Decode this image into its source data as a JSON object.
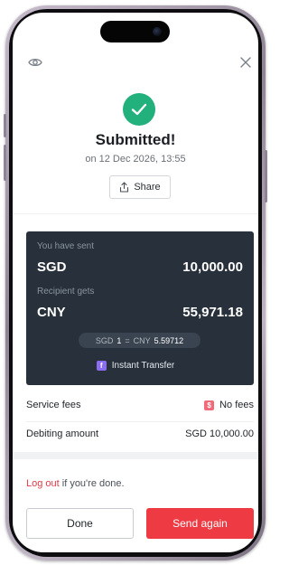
{
  "header": {
    "hide_balance_icon": "eye-icon",
    "close_icon": "close-icon"
  },
  "status": {
    "icon": "check-icon",
    "title": "Submitted!",
    "timestamp": "on 12 Dec 2026, 13:55",
    "share_label": "Share"
  },
  "transfer": {
    "sent_label": "You have sent",
    "sent_currency": "SGD",
    "sent_amount": "10,000.00",
    "received_label": "Recipient gets",
    "received_currency": "CNY",
    "received_amount": "55,971.18",
    "rate": {
      "from_currency": "SGD",
      "from_value": "1",
      "equals": "=",
      "to_currency": "CNY",
      "to_value": "5.59712"
    },
    "method_badge": "f",
    "method_label": "Instant Transfer"
  },
  "summary": {
    "fees_label": "Service fees",
    "fees_badge": "$",
    "fees_value": "No fees",
    "debit_label": "Debiting amount",
    "debit_value": "SGD 10,000.00"
  },
  "footer": {
    "logout_link": "Log out",
    "logout_suffix": " if you're done.",
    "done_label": "Done",
    "send_again_label": "Send again"
  },
  "colors": {
    "success": "#22b07d",
    "card_bg": "#27303b",
    "accent_red": "#ee3a43",
    "instant_badge": "#8a6df0",
    "fee_badge": "#ef6b7a"
  }
}
